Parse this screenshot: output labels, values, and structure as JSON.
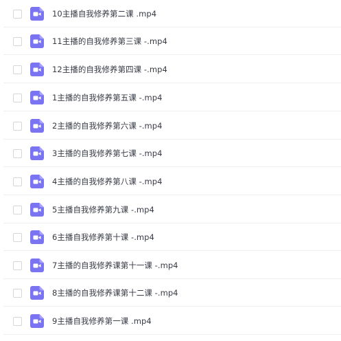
{
  "file_list": {
    "icon_color": "#7b74f2",
    "items": [
      {
        "name": "10主播自我修养第二课 .mp4",
        "icon": "video-file-icon"
      },
      {
        "name": "11主播的自我修养第三课 -.mp4",
        "icon": "video-file-icon"
      },
      {
        "name": "12主播的自我修养第四课 -.mp4",
        "icon": "video-file-icon"
      },
      {
        "name": "1主播的自我修养第五课 -.mp4",
        "icon": "video-file-icon"
      },
      {
        "name": "2主播的自我修养第六课 -.mp4",
        "icon": "video-file-icon"
      },
      {
        "name": "3主播的自我修养第七课 -.mp4",
        "icon": "video-file-icon"
      },
      {
        "name": "4主播的自我修养第八课 -.mp4",
        "icon": "video-file-icon"
      },
      {
        "name": "5主播自我修养第九课 -.mp4",
        "icon": "video-file-icon"
      },
      {
        "name": "6主播自我修养第十课 -.mp4",
        "icon": "video-file-icon"
      },
      {
        "name": "7主播的自我修养课第十一课 -.mp4",
        "icon": "video-file-icon"
      },
      {
        "name": "8主播的自我修养课第十二课 -.mp4",
        "icon": "video-file-icon"
      },
      {
        "name": "9主播自我修养第一课 .mp4",
        "icon": "video-file-icon"
      }
    ]
  }
}
